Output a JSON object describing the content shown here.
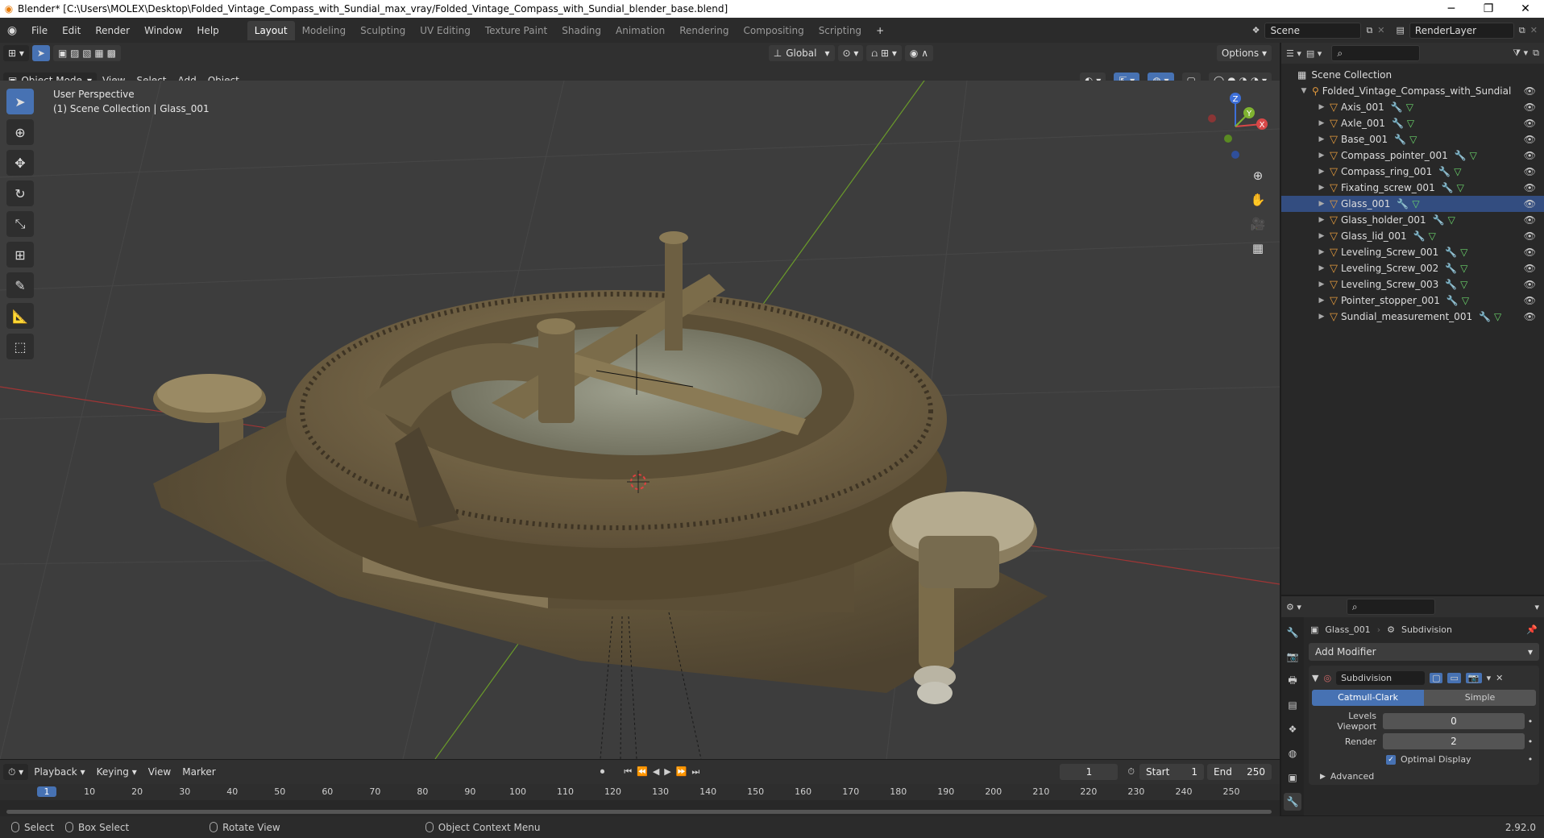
{
  "window": {
    "title": "Blender* [C:\\Users\\MOLEX\\Desktop\\Folded_Vintage_Compass_with_Sundial_max_vray/Folded_Vintage_Compass_with_Sundial_blender_base.blend]"
  },
  "menu": [
    "File",
    "Edit",
    "Render",
    "Window",
    "Help"
  ],
  "workspaces": [
    "Layout",
    "Modeling",
    "Sculpting",
    "UV Editing",
    "Texture Paint",
    "Shading",
    "Animation",
    "Rendering",
    "Compositing",
    "Scripting"
  ],
  "active_workspace": "Layout",
  "scene_selector": "Scene",
  "view_layer_selector": "RenderLayer",
  "viewport": {
    "mode": "Object Mode",
    "menus": [
      "View",
      "Select",
      "Add",
      "Object"
    ],
    "transform_orientation": "Global",
    "options_label": "Options",
    "view_name": "User Perspective",
    "collection_info": "(1) Scene Collection | Glass_001",
    "gizmo_axes": {
      "x": "X",
      "y": "Y",
      "z": "Z"
    }
  },
  "outliner": {
    "root": "Scene Collection",
    "collection": "Folded_Vintage_Compass_with_Sundial",
    "objects": [
      "Axis_001",
      "Axle_001",
      "Base_001",
      "Compass_pointer_001",
      "Compass_ring_001",
      "Fixating_screw_001",
      "Glass_001",
      "Glass_holder_001",
      "Glass_lid_001",
      "Leveling_Screw_001",
      "Leveling_Screw_002",
      "Leveling_Screw_003",
      "Pointer_stopper_001",
      "Sundial_measurement_001"
    ]
  },
  "properties": {
    "object_name": "Glass_001",
    "modifier_breadcrumb": "Subdivision",
    "add_modifier_label": "Add Modifier",
    "modifier_name": "Subdivision",
    "algo_options": [
      "Catmull-Clark",
      "Simple"
    ],
    "active_algo": "Catmull-Clark",
    "levels_viewport_label": "Levels Viewport",
    "levels_viewport_value": "0",
    "render_label": "Render",
    "render_value": "2",
    "optimal_display_label": "Optimal Display",
    "advanced_label": "Advanced"
  },
  "timeline": {
    "menus": [
      "Playback",
      "Keying",
      "View",
      "Marker"
    ],
    "current_frame": "1",
    "start_label": "Start",
    "start_value": "1",
    "end_label": "End",
    "end_value": "250",
    "ticks": [
      "1",
      "10",
      "20",
      "30",
      "40",
      "50",
      "60",
      "70",
      "80",
      "90",
      "100",
      "110",
      "120",
      "130",
      "140",
      "150",
      "160",
      "170",
      "180",
      "190",
      "200",
      "210",
      "220",
      "230",
      "240",
      "250"
    ]
  },
  "status": {
    "select": "Select",
    "box_select": "Box Select",
    "rotate_view": "Rotate View",
    "context_menu": "Object Context Menu",
    "version": "2.92.0"
  }
}
